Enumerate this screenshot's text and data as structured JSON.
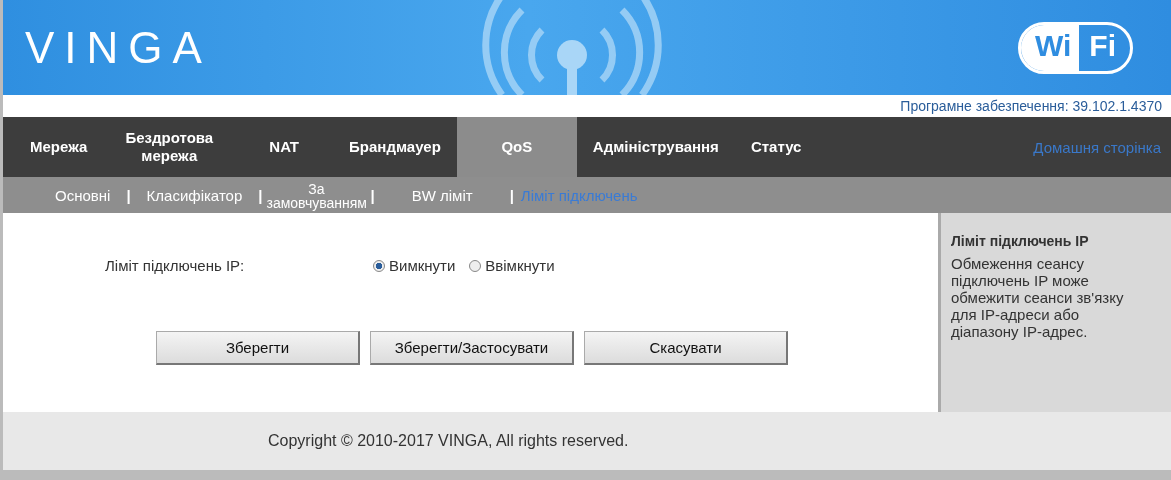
{
  "header": {
    "logo": "VINGA",
    "badge": [
      "Wi",
      "Fi"
    ]
  },
  "firmware": "Програмне забезпечення: 39.102.1.4370",
  "nav": {
    "items": [
      {
        "label": "Мережа",
        "selected": false
      },
      {
        "label": "Бездротова мережа",
        "selected": false
      },
      {
        "label": "NAT",
        "selected": false
      },
      {
        "label": "Брандмауер",
        "selected": false
      },
      {
        "label": "QoS",
        "selected": true
      },
      {
        "label": "Адміністрування",
        "selected": false
      },
      {
        "label": "Статус",
        "selected": false
      }
    ],
    "home_link": "Домашня сторінка"
  },
  "subnav": [
    {
      "label": "Основні",
      "selected": false
    },
    {
      "divider": "|",
      "label": "Класифікатор",
      "selected": false
    },
    {
      "divider": "|",
      "label": "За замовчуванням",
      "selected": false
    },
    {
      "divider": "|",
      "label": "BW ліміт",
      "selected": false
    },
    {
      "divider": "|",
      "label": "Ліміт підключень",
      "selected": true
    }
  ],
  "form": {
    "label": "Ліміт підключень IP:",
    "options": [
      {
        "label": "Вимкнути",
        "selected": true
      },
      {
        "label": "Ввімкнути",
        "selected": false
      }
    ]
  },
  "buttons": [
    "Зберегти",
    "Зберегти/Застосувати",
    "Скасувати"
  ],
  "help": {
    "title": "Ліміт підключень IP",
    "text": "Обмеження сеансу підключень IP може обмежити сеанси зв'язку для IP-адреси або діапазону IP-адрес."
  },
  "footer": "Copyright © 2010-2017 VINGA, All rights reserved."
}
